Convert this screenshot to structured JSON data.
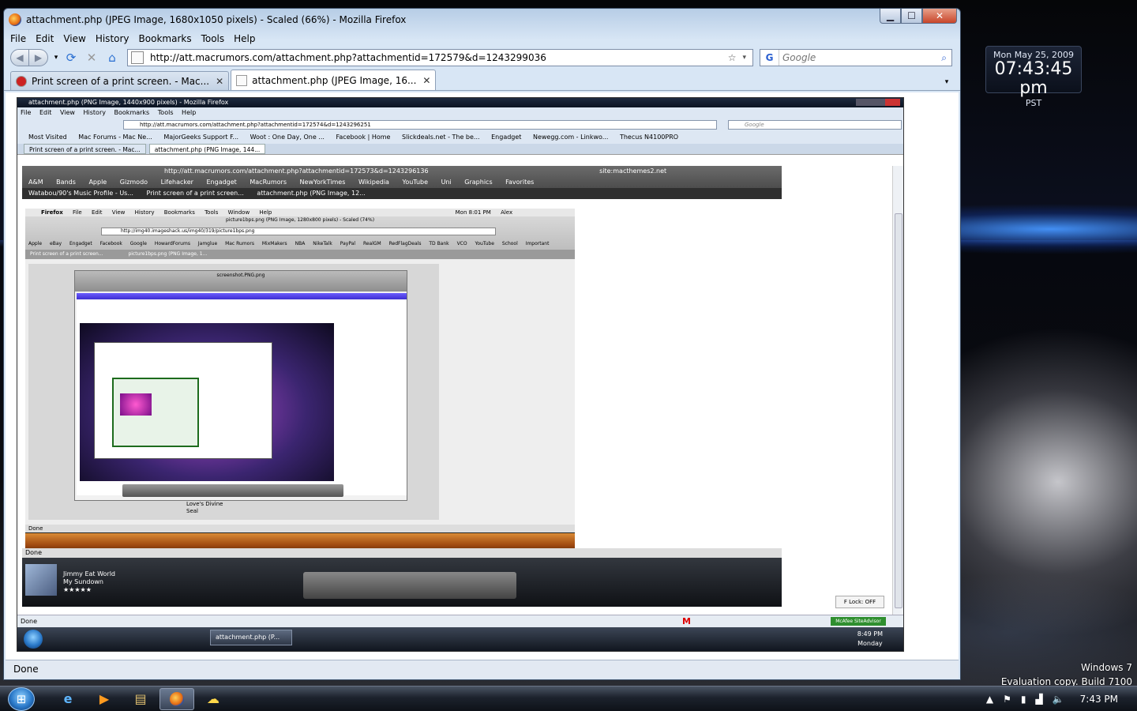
{
  "desktop": {
    "clock_gadget": {
      "date": "Mon May 25, 2009",
      "time": "07:43:45 pm",
      "tz": "PST"
    },
    "watermark": {
      "line1": "Windows 7",
      "line2": "Evaluation copy. Build 7100"
    }
  },
  "taskbar": {
    "clock": "7:43 PM",
    "icons": [
      "ie-icon",
      "media-player-icon",
      "explorer-icon",
      "firefox-icon",
      "weather-icon"
    ]
  },
  "window": {
    "title": "attachment.php (JPEG Image, 1680x1050 pixels) - Scaled (66%) - Mozilla Firefox",
    "menu": [
      "File",
      "Edit",
      "View",
      "History",
      "Bookmarks",
      "Tools",
      "Help"
    ],
    "url": "http://att.macrumors.com/attachment.php?attachmentid=172579&d=1243299036",
    "search_placeholder": "Google",
    "tabs": [
      {
        "label": "Print screen of a print screen. - Mac...",
        "active": false
      },
      {
        "label": "attachment.php (JPEG Image, 16...",
        "active": true
      }
    ],
    "status": "Done"
  },
  "nested1": {
    "title": "attachment.php (PNG Image, 1440x900 pixels) - Mozilla Firefox",
    "menu": [
      "File",
      "Edit",
      "View",
      "History",
      "Bookmarks",
      "Tools",
      "Help"
    ],
    "url": "http://att.macrumors.com/attachment.php?attachmentid=172574&d=1243296251",
    "search_placeholder": "Google",
    "bookmarks": [
      "Most Visited",
      "Mac Forums - Mac Ne...",
      "MajorGeeks Support F...",
      "Woot : One Day, One ...",
      "Facebook | Home",
      "Slickdeals.net - The be...",
      "Engadget",
      "Newegg.com - Linkwo...",
      "Thecus N4100PRO"
    ],
    "tabs": [
      "Print screen of a print screen. - Mac...",
      "attachment.php (PNG Image, 144..."
    ],
    "status": "Done",
    "caps_lock": "F Lock: OFF",
    "mcafee": "McAfee SiteAdvisor",
    "task": "attachment.php (P...",
    "clock_time": "8:49 PM",
    "clock_day": "Monday"
  },
  "nested2": {
    "url_fragment": "http://att.macrumors.com/attachment.php?attachmentid=172573&d=1243296136",
    "search_text": "site:macthemes2.net",
    "bookmarks": [
      "A&M",
      "Bands",
      "Apple",
      "Gizmodo",
      "Lifehacker",
      "Engadget",
      "MacRumors",
      "NewYorkTimes",
      "Wikipedia",
      "YouTube",
      "Uni",
      "Graphics",
      "Favorites"
    ],
    "tabs": [
      "Watabou/90's Music Profile - Us...",
      "Print screen of a print screen...",
      "attachment.php (PNG Image, 12..."
    ],
    "status": "Done",
    "artist": "Jimmy Eat World",
    "song": "My Sundown",
    "rating": "★★★★★"
  },
  "nested3": {
    "menu": [
      "Firefox",
      "File",
      "Edit",
      "View",
      "History",
      "Bookmarks",
      "Tools",
      "Window",
      "Help"
    ],
    "clock": "Mon 8:01 PM",
    "user": "Alex",
    "title": "picture1bps.png (PNG Image, 1280x800 pixels) - Scaled (74%)",
    "url": "http://img40.imageshack.us/img40/319/picture1bps.png",
    "bookmarks": [
      "Apple",
      "eBay",
      "Engadget",
      "Facebook",
      "Google",
      "HowardForums",
      "Jamglue",
      "Mac Rumors",
      "MixMakers",
      "NBA",
      "NikeTalk",
      "PayPal",
      "RealGM",
      "RedFlagDeals",
      "TD Bank",
      "VCO",
      "YouTube",
      "School",
      "Important"
    ],
    "tabs": [
      "Print screen of a print screen...",
      "picture1bps.png (PNG Image, 1..."
    ],
    "preview_title": "screenshot.PNG.png",
    "status": "Done",
    "track": "Love's Divine",
    "artist": "Seal"
  }
}
